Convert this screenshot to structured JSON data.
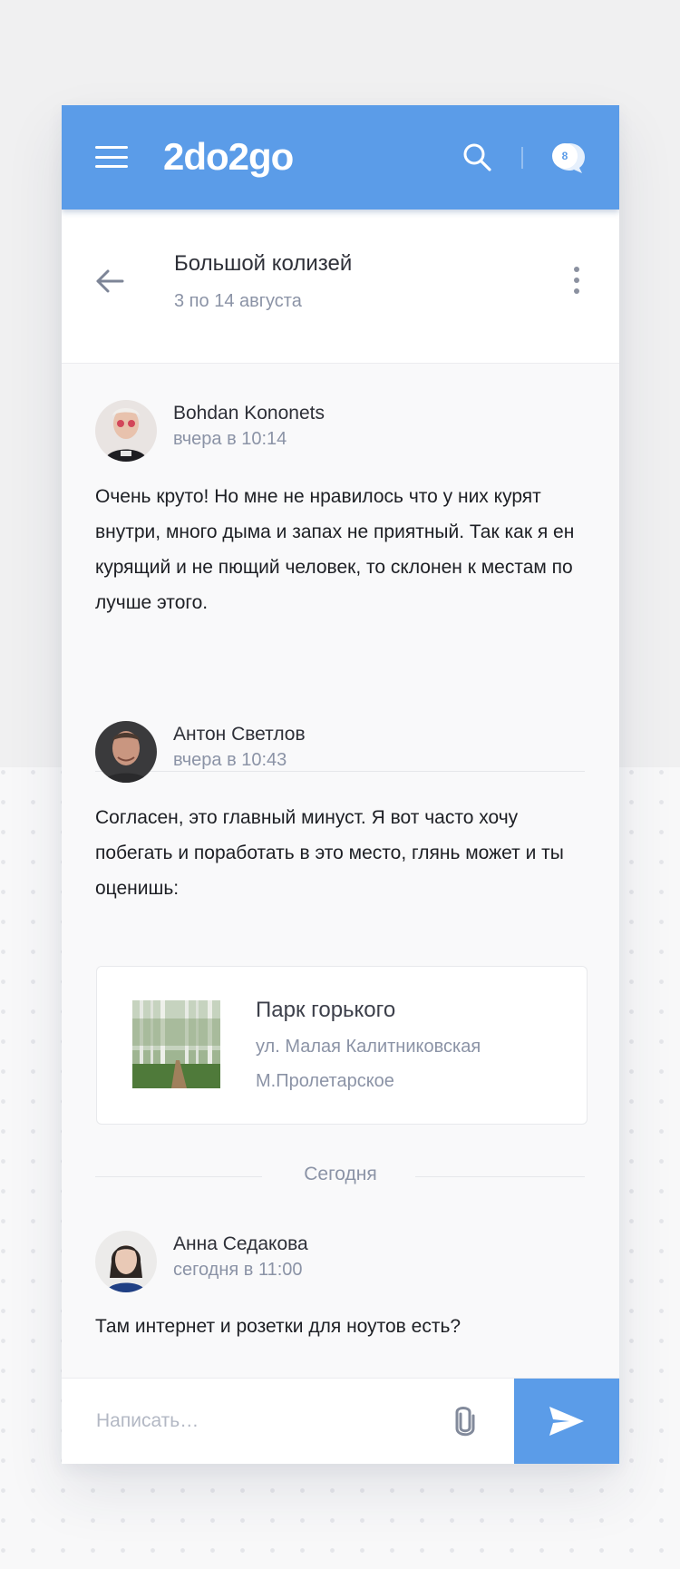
{
  "app": {
    "logo": "2do2go",
    "accent_color": "#5b9ce8",
    "icons": {
      "menu": "hamburger-menu-icon",
      "search": "search-icon",
      "chat": "chat-bubble-icon"
    },
    "chat_unread_count": "8"
  },
  "event": {
    "title": "Большой колизей",
    "dates": "3 по 14 августа",
    "icons": {
      "back": "arrow-left-icon",
      "more": "more-vertical-icon"
    }
  },
  "messages": [
    {
      "author": "Bohdan Kononets",
      "time": "вчера в 10:14",
      "text": "Очень круто! Но мне не нравилось что у них курят внутри, много дыма и запах не приятный. Так как я ен курящий и не пющий человек, то склонен к местам по лучше этого."
    },
    {
      "author": "Антон Светлов",
      "time": "вчера в 10:43",
      "text": "Согласен, это главный минуст. Я вот часто хочу побегать и поработать в это место, глянь может и ты оценишь:",
      "place": {
        "name": "Парк горького",
        "address": "ул. Малая Калитниковская",
        "metro": "М.Пролетарское"
      }
    },
    {
      "author": "Анна Седакова",
      "time": "сегодня в 11:00",
      "text": "Там интернет и розетки для ноутов есть?"
    }
  ],
  "day_divider": "Сегодня",
  "composer": {
    "placeholder": "Написать…",
    "icons": {
      "attach": "paperclip-icon",
      "send": "send-icon"
    }
  }
}
